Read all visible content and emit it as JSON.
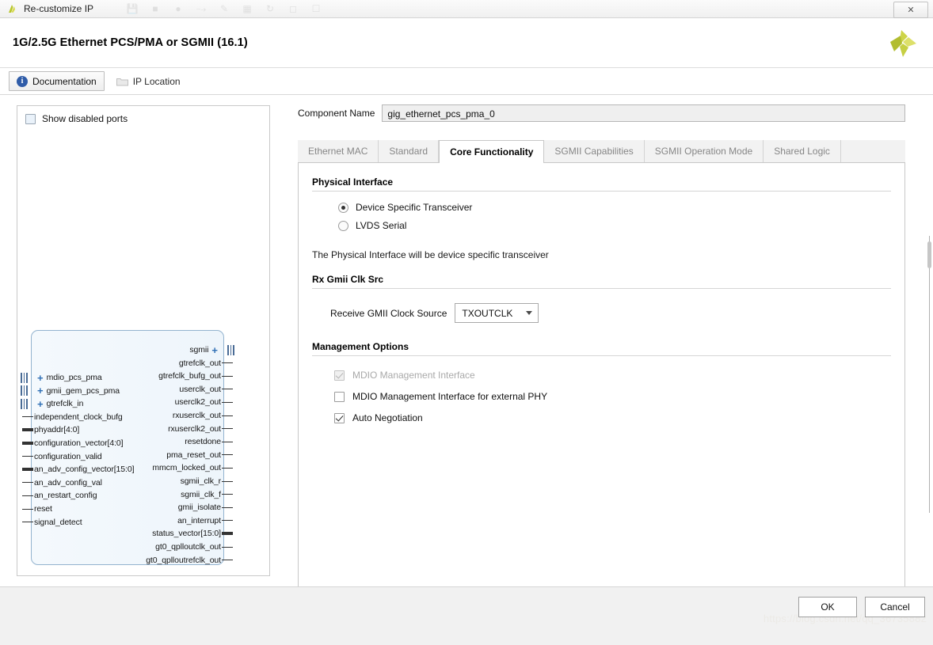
{
  "window": {
    "title": "Re-customize IP",
    "app_icon": "xilinx-vivado-icon",
    "close_label": "✕",
    "toolbar_icons": [
      "save-icon",
      "board-icon",
      "target-icon",
      "wire-icon",
      "pencil-icon",
      "grid-icon",
      "refresh-icon",
      "trash-icon",
      "zoom-icon"
    ]
  },
  "header": {
    "title": "1G/2.5G Ethernet PCS/PMA or SGMII (16.1)",
    "logo": "xilinx-logo"
  },
  "toolstrip": {
    "documentation_label": "Documentation",
    "documentation_icon": "info-icon",
    "ip_location_label": "IP Location",
    "ip_location_icon": "folder-icon"
  },
  "diagram": {
    "show_disabled_ports_label": "Show disabled ports",
    "show_disabled_ports_checked": false,
    "left_ports": [
      {
        "name": "mdio_pcs_pma",
        "type": "bus"
      },
      {
        "name": "gmii_gem_pcs_pma",
        "type": "bus"
      },
      {
        "name": "gtrefclk_in",
        "type": "bus"
      },
      {
        "name": "independent_clock_bufg",
        "type": "single"
      },
      {
        "name": "phyaddr[4:0]",
        "type": "thick"
      },
      {
        "name": "configuration_vector[4:0]",
        "type": "thick"
      },
      {
        "name": "configuration_valid",
        "type": "single"
      },
      {
        "name": "an_adv_config_vector[15:0]",
        "type": "thick"
      },
      {
        "name": "an_adv_config_val",
        "type": "single"
      },
      {
        "name": "an_restart_config",
        "type": "single"
      },
      {
        "name": "reset",
        "type": "single"
      },
      {
        "name": "signal_detect",
        "type": "single"
      }
    ],
    "right_ports": [
      {
        "name": "sgmii",
        "type": "bus"
      },
      {
        "name": "gtrefclk_out",
        "type": "single"
      },
      {
        "name": "gtrefclk_bufg_out",
        "type": "single"
      },
      {
        "name": "userclk_out",
        "type": "single"
      },
      {
        "name": "userclk2_out",
        "type": "single"
      },
      {
        "name": "rxuserclk_out",
        "type": "single"
      },
      {
        "name": "rxuserclk2_out",
        "type": "single"
      },
      {
        "name": "resetdone",
        "type": "single"
      },
      {
        "name": "pma_reset_out",
        "type": "single"
      },
      {
        "name": "mmcm_locked_out",
        "type": "single"
      },
      {
        "name": "sgmii_clk_r",
        "type": "single"
      },
      {
        "name": "sgmii_clk_f",
        "type": "single"
      },
      {
        "name": "gmii_isolate",
        "type": "single"
      },
      {
        "name": "an_interrupt",
        "type": "single"
      },
      {
        "name": "status_vector[15:0]",
        "type": "thick"
      },
      {
        "name": "gt0_qplloutclk_out",
        "type": "single"
      },
      {
        "name": "gt0_qplloutrefclk_out",
        "type": "single"
      }
    ]
  },
  "config": {
    "component_name_label": "Component Name",
    "component_name_value": "gig_ethernet_pcs_pma_0",
    "tabs": [
      {
        "label": "Ethernet MAC",
        "active": false
      },
      {
        "label": "Standard",
        "active": false
      },
      {
        "label": "Core Functionality",
        "active": true
      },
      {
        "label": "SGMII Capabilities",
        "active": false
      },
      {
        "label": "SGMII Operation Mode",
        "active": false
      },
      {
        "label": "Shared Logic",
        "active": false
      }
    ],
    "physical_interface": {
      "title": "Physical Interface",
      "options": [
        {
          "label": "Device Specific Transceiver",
          "selected": true
        },
        {
          "label": "LVDS Serial",
          "selected": false
        }
      ],
      "note": "The Physical Interface will be device specific transceiver"
    },
    "rx_gmii_clk_src": {
      "title": "Rx Gmii Clk Src",
      "field_label": "Receive GMII Clock Source",
      "value": "TXOUTCLK",
      "chevron_icon": "chevron-down-icon"
    },
    "management_options": {
      "title": "Management Options",
      "items": [
        {
          "label": "MDIO Management Interface",
          "checked": true,
          "disabled": true
        },
        {
          "label": "MDIO Management Interface for external PHY",
          "checked": false,
          "disabled": false
        },
        {
          "label": "Auto Negotiation",
          "checked": true,
          "disabled": false
        }
      ]
    }
  },
  "footer": {
    "ok_label": "OK",
    "cancel_label": "Cancel",
    "watermark": "https://blog.csdn.net/qq_36735882"
  }
}
